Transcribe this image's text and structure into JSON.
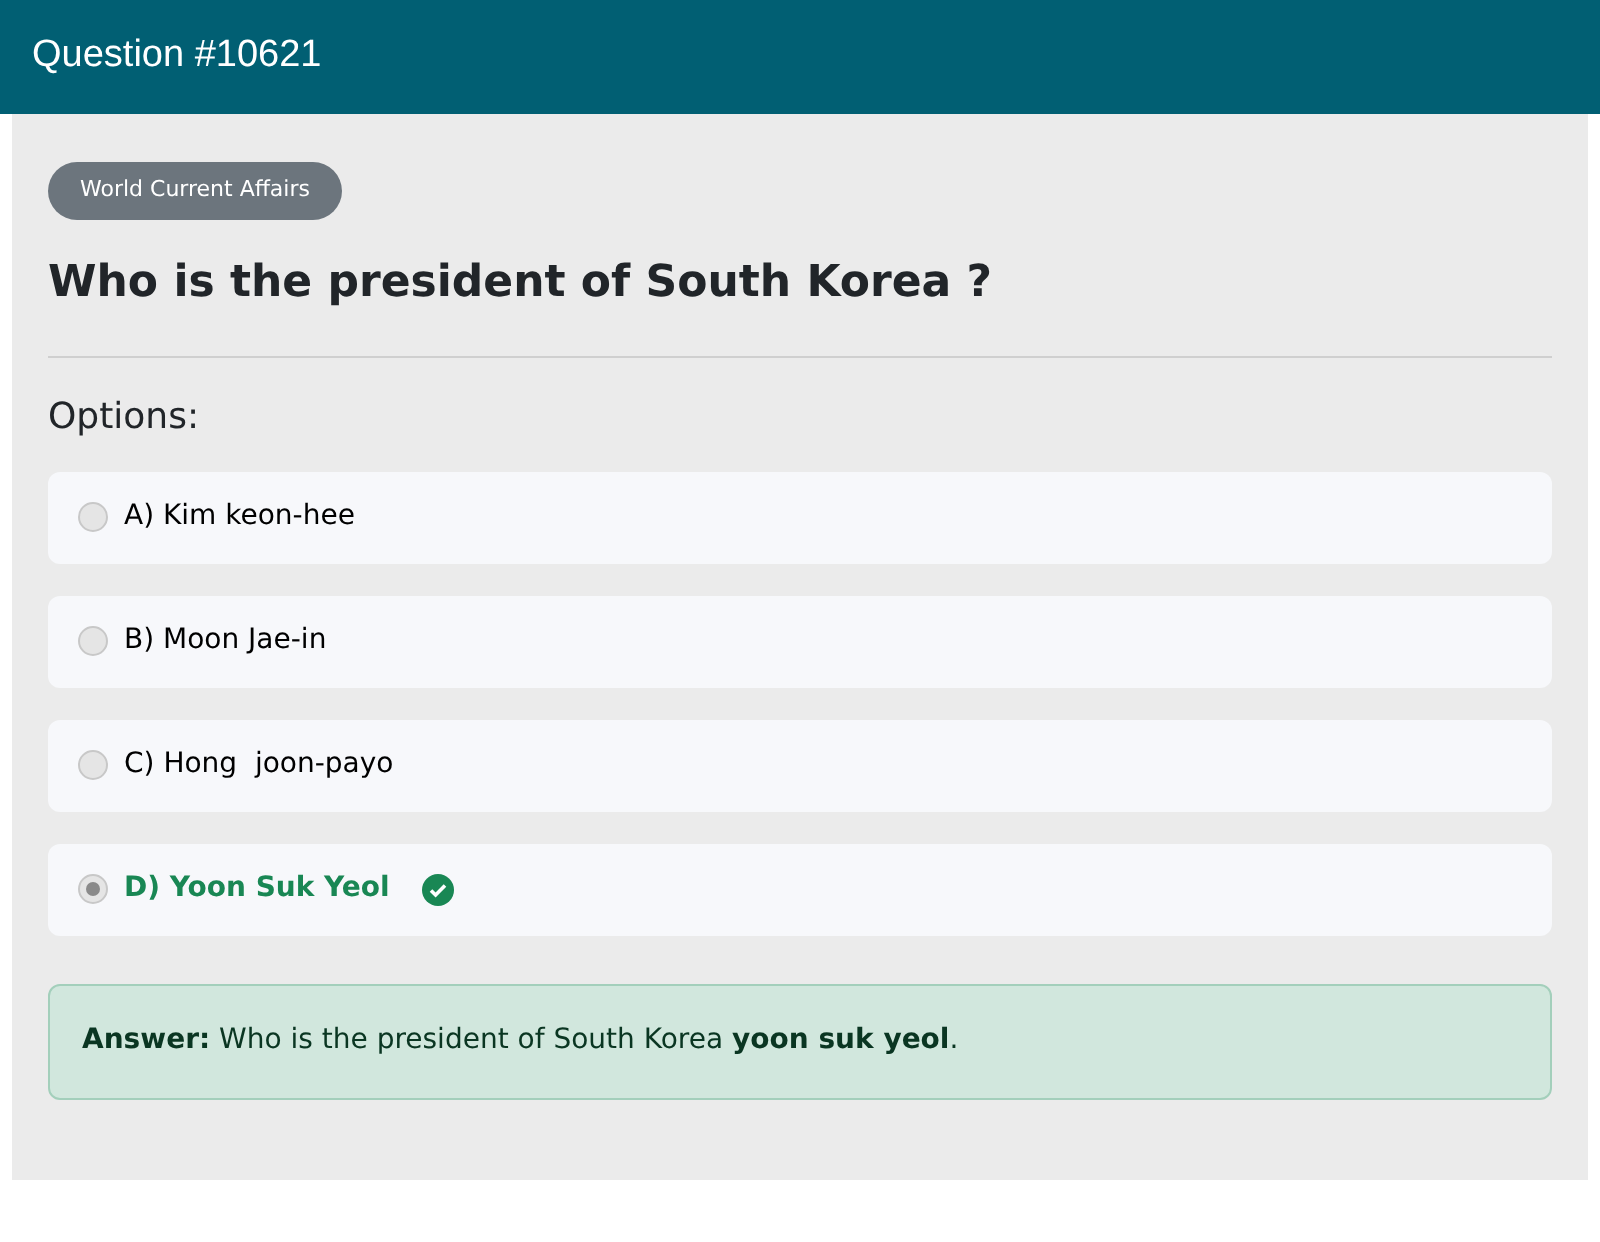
{
  "header": {
    "title": "Question #10621"
  },
  "category": "World Current Affairs",
  "question": "Who is the president of South Korea ?",
  "options_label": "Options:",
  "options": [
    {
      "label": "A) Kim keon-hee",
      "selected": false,
      "correct": false
    },
    {
      "label": "B) Moon Jae-in",
      "selected": false,
      "correct": false
    },
    {
      "label": "C) Hong  joon-payo",
      "selected": false,
      "correct": false
    },
    {
      "label": "D) Yoon Suk Yeol",
      "selected": true,
      "correct": true
    }
  ],
  "answer": "**Answer:** Who is the president of South Korea **yoon suk yeol**."
}
